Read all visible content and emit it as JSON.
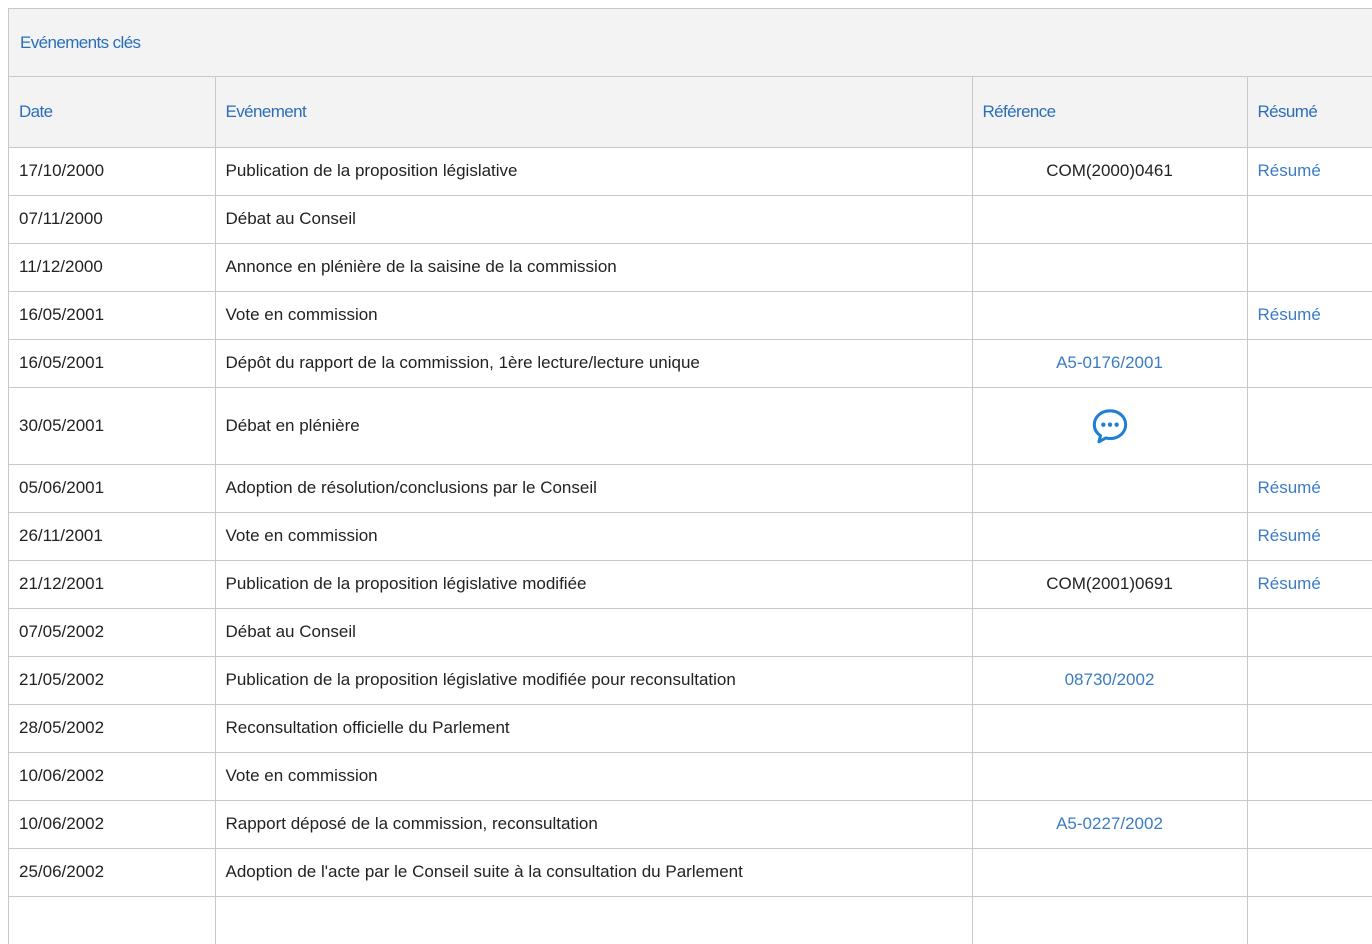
{
  "panel": {
    "title": "Evénements clés"
  },
  "columns": {
    "date": "Date",
    "event": "Evénement",
    "reference": "Référence",
    "summary": "Résumé"
  },
  "rows": [
    {
      "date": "17/10/2000",
      "event": "Publication de la proposition législative",
      "reference": "COM(2000)0461",
      "reference_is_link": false,
      "summary": "Résumé"
    },
    {
      "date": "07/11/2000",
      "event": "Débat au Conseil",
      "reference": "",
      "reference_is_link": false,
      "summary": ""
    },
    {
      "date": "11/12/2000",
      "event": "Annonce en plénière de la saisine de la commission",
      "reference": "",
      "reference_is_link": false,
      "summary": ""
    },
    {
      "date": "16/05/2001",
      "event": "Vote en commission",
      "reference": "",
      "reference_is_link": false,
      "summary": "Résumé"
    },
    {
      "date": "16/05/2001",
      "event": "Dépôt du rapport de la commission, 1ère lecture/lecture unique",
      "reference": "A5-0176/2001",
      "reference_is_link": true,
      "summary": ""
    },
    {
      "date": "30/05/2001",
      "event": "Débat en plénière",
      "reference_icon": "chat-bubble-icon",
      "summary": ""
    },
    {
      "date": "05/06/2001",
      "event": "Adoption de résolution/conclusions par le Conseil",
      "reference": "",
      "reference_is_link": false,
      "summary": "Résumé"
    },
    {
      "date": "26/11/2001",
      "event": "Vote en commission",
      "reference": "",
      "reference_is_link": false,
      "summary": "Résumé"
    },
    {
      "date": "21/12/2001",
      "event": "Publication de la proposition législative modifiée",
      "reference": "COM(2001)0691",
      "reference_is_link": false,
      "summary": "Résumé"
    },
    {
      "date": "07/05/2002",
      "event": "Débat au Conseil",
      "reference": "",
      "reference_is_link": false,
      "summary": ""
    },
    {
      "date": "21/05/2002",
      "event": "Publication de la proposition législative modifiée pour reconsultation",
      "reference": "08730/2002",
      "reference_is_link": true,
      "summary": ""
    },
    {
      "date": "28/05/2002",
      "event": "Reconsultation officielle du Parlement",
      "reference": "",
      "reference_is_link": false,
      "summary": ""
    },
    {
      "date": "10/06/2002",
      "event": "Vote en commission",
      "reference": "",
      "reference_is_link": false,
      "summary": ""
    },
    {
      "date": "10/06/2002",
      "event": "Rapport déposé de la commission, reconsultation",
      "reference": "A5-0227/2002",
      "reference_is_link": true,
      "summary": ""
    },
    {
      "date": "25/06/2002",
      "event": "Adoption de l'acte par le Conseil suite à la consultation du Parlement",
      "reference": "",
      "reference_is_link": false,
      "summary": ""
    }
  ],
  "colors": {
    "accent": "#2a6ebb",
    "link": "#3a7cc4",
    "header_bg": "#f3f3f3",
    "border": "#c8c8c8"
  }
}
